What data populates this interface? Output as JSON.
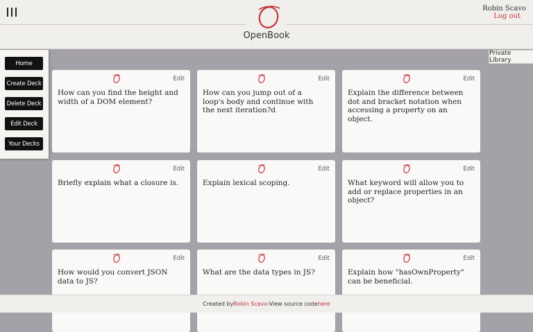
{
  "header": {
    "app_name": "OpenBook",
    "user_name": "Robin Scavo",
    "logout_label": "Log out",
    "accent_color": "#c0343a"
  },
  "private_library_label": "Private Library",
  "sidebar": {
    "items": [
      {
        "label": "Home"
      },
      {
        "label": "Create Deck"
      },
      {
        "label": "Delete Deck"
      },
      {
        "label": "Edit Deck"
      },
      {
        "label": "Your Decks"
      }
    ]
  },
  "cards": [
    {
      "edit": "Edit",
      "question": "How can you find the height and width of a DOM element?"
    },
    {
      "edit": "Edit",
      "question": "How can you jump out of a loop's body and continue with the next iteration?d"
    },
    {
      "edit": "Edit",
      "question": "Explain the difference between dot and bracket notation when accessing a property on an object."
    },
    {
      "edit": "Edit",
      "question": "Briefly explain what a closure is."
    },
    {
      "edit": "Edit",
      "question": "Explain lexical scoping."
    },
    {
      "edit": "Edit",
      "question": "What keyword will allow you to add or replace properties in an object?"
    },
    {
      "edit": "Edit",
      "question": "How would you convert JSON data to JS?"
    },
    {
      "edit": "Edit",
      "question": "What are the data types in JS?"
    },
    {
      "edit": "Edit",
      "question": "Explain how \"hasOwnProperty\" can be beneficial."
    }
  ],
  "footer": {
    "created_by": "Created by ",
    "author": "Robin Scavo",
    "view_source": " -View source code ",
    "here": "here"
  }
}
